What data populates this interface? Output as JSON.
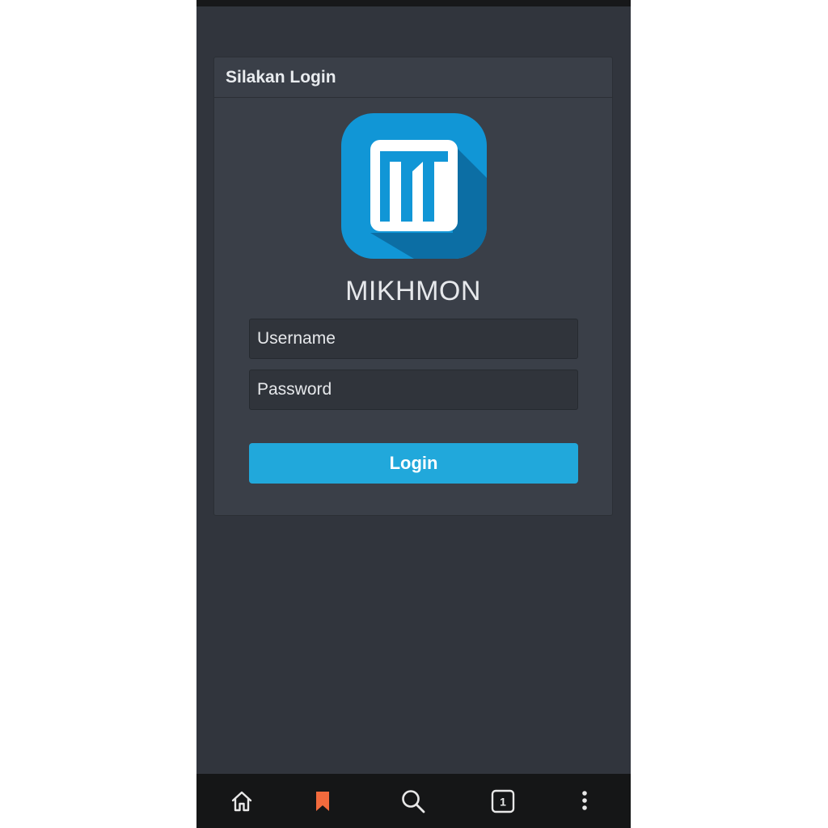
{
  "login_panel": {
    "title": "Silakan Login",
    "app_name": "MIKHMON",
    "username_placeholder": "Username",
    "password_placeholder": "Password",
    "login_button": "Login"
  },
  "logo": {
    "icon": "mikhmon-logo-icon",
    "bg_color": "#1196d6",
    "shadow_color": "#0c6ea4"
  },
  "bottom_nav": {
    "items": [
      {
        "icon": "home-icon"
      },
      {
        "icon": "bookmark-icon",
        "color": "#f26a3d"
      },
      {
        "icon": "search-icon"
      },
      {
        "icon": "tabs-icon",
        "tab_count": "1"
      },
      {
        "icon": "more-vertical-icon"
      }
    ]
  },
  "colors": {
    "accent": "#21a8db",
    "background": "#31353d",
    "card": "#3a3f48"
  }
}
